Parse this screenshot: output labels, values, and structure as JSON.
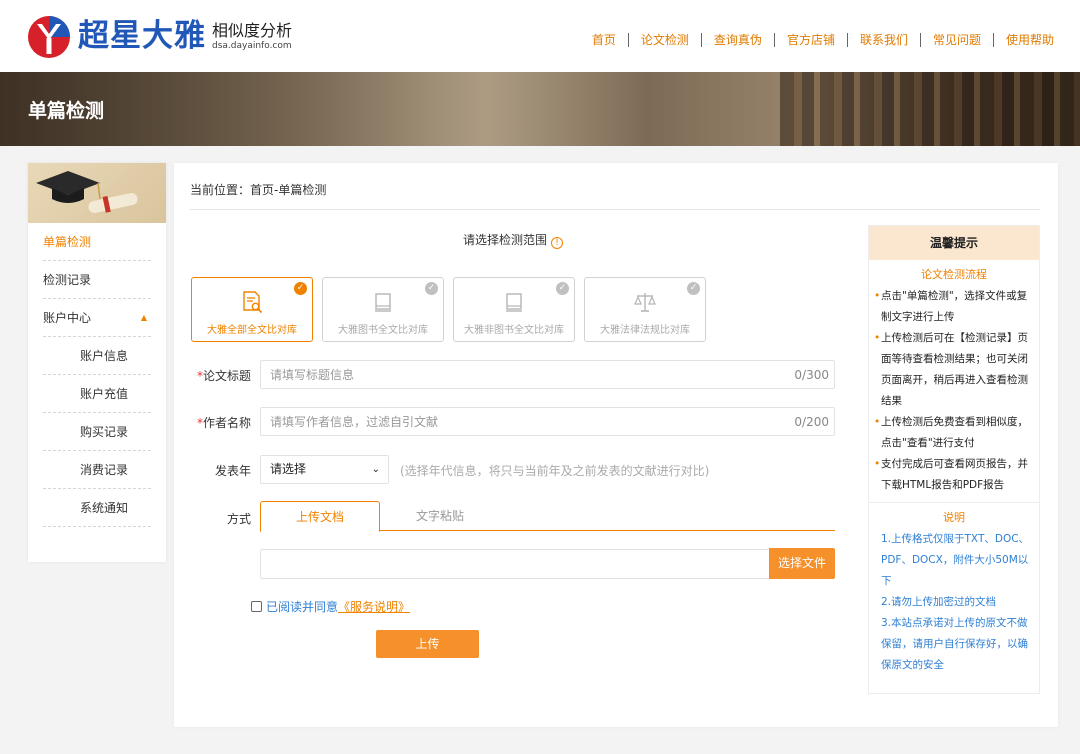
{
  "header": {
    "logo_title": "超星大雅",
    "logo_subtitle": "相似度分析",
    "logo_domain": "dsa.dayainfo.com",
    "nav": [
      "首页",
      "论文检测",
      "查询真伪",
      "官方店铺",
      "联系我们",
      "常见问题",
      "使用帮助"
    ]
  },
  "banner": {
    "title": "单篇检测"
  },
  "sidebar": {
    "items": [
      {
        "label": "单篇检测"
      },
      {
        "label": "检测记录"
      },
      {
        "label": "账户中心",
        "arrow": "▲"
      },
      {
        "label": "账户信息"
      },
      {
        "label": "账户充值"
      },
      {
        "label": "购买记录"
      },
      {
        "label": "消费记录"
      },
      {
        "label": "系统通知"
      }
    ]
  },
  "main": {
    "breadcrumb": "当前位置：首页-单篇检测",
    "scope_title": "请选择检测范围",
    "scope_cards": [
      {
        "label": "大雅全部全文比对库",
        "icon": "document-search-icon",
        "selected": true
      },
      {
        "label": "大雅图书全文比对库",
        "icon": "book-icon",
        "selected": false
      },
      {
        "label": "大雅非图书全文比对库",
        "icon": "book-icon",
        "selected": false
      },
      {
        "label": "大雅法律法规比对库",
        "icon": "scale-icon",
        "selected": false
      }
    ],
    "title_field": {
      "label": "论文标题",
      "required": "*",
      "placeholder": "请填写标题信息",
      "count": "0/300"
    },
    "author_field": {
      "label": "作者名称",
      "required": "*",
      "placeholder": "请填写作者信息，过滤自引文献",
      "count": "0/200"
    },
    "year": {
      "label": "发表年",
      "value": "请选择",
      "hint": "(选择年代信息，将只与当前年及之前发表的文献进行对比)"
    },
    "method": {
      "label": "方式",
      "tabs": [
        "上传文档",
        "文字粘贴"
      ]
    },
    "file_button": "选择文件",
    "agree_text": "已阅读并同意",
    "agree_link": "《服务说明》",
    "upload_button": "上传"
  },
  "tips": {
    "title": "温馨提示",
    "flow_title": "论文检测流程",
    "flow": [
      "点击\"单篇检测\"，选择文件或复制文字进行上传",
      "上传检测后可在【检测记录】页面等待查看检测结果；也可关闭页面离开，稍后再进入查看检测结果",
      "上传检测后免费查看到相似度，点击\"查看\"进行支付",
      "支付完成后可查看网页报告，并下载HTML报告和PDF报告"
    ],
    "notes_title": "说明",
    "notes": [
      "1.上传格式仅限于TXT、DOC、PDF、DOCX，附件大小50M以下",
      "2.请勿上传加密过的文档",
      "3.本站点承诺对上传的原文不做保留，请用户自行保存好，以确保原文的安全"
    ]
  },
  "colors": {
    "accent": "#f08200",
    "button": "#f5902a",
    "brand_blue": "#2158b8",
    "link_blue": "#2f7fd3"
  }
}
